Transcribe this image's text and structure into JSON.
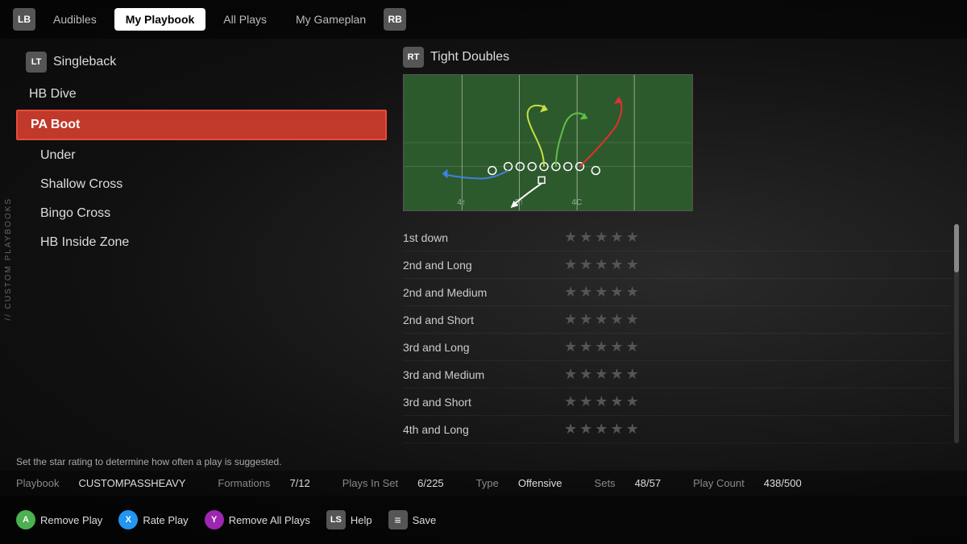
{
  "nav": {
    "lb_label": "LB",
    "rb_label": "RB",
    "tabs": [
      {
        "label": "Audibles",
        "active": false
      },
      {
        "label": "My Playbook",
        "active": true
      },
      {
        "label": "All Plays",
        "active": false
      },
      {
        "label": "My Gameplan",
        "active": false
      }
    ]
  },
  "side_label": "// CUSTOM PLAYBOOKS",
  "left_panel": {
    "formation_badge": "LT",
    "formation_name": "Singleback",
    "plays": [
      {
        "label": "HB Dive",
        "selected": false,
        "indented": false
      },
      {
        "label": "PA Boot",
        "selected": true,
        "indented": false
      },
      {
        "label": "Under",
        "selected": false,
        "indented": true
      },
      {
        "label": "Shallow Cross",
        "selected": false,
        "indented": true
      },
      {
        "label": "Bingo Cross",
        "selected": false,
        "indented": true
      },
      {
        "label": "HB Inside Zone",
        "selected": false,
        "indented": true
      }
    ]
  },
  "right_panel": {
    "set_badge": "RT",
    "set_name": "Tight Doubles",
    "ratings": [
      {
        "label": "1st down",
        "stars": 0
      },
      {
        "label": "2nd and Long",
        "stars": 0
      },
      {
        "label": "2nd and Medium",
        "stars": 0
      },
      {
        "label": "2nd and Short",
        "stars": 0
      },
      {
        "label": "3rd and Long",
        "stars": 0
      },
      {
        "label": "3rd and Medium",
        "stars": 0
      },
      {
        "label": "3rd and Short",
        "stars": 0
      },
      {
        "label": "4th and Long",
        "stars": 0
      }
    ],
    "max_stars": 5
  },
  "info_text": "Set the star rating to determine how often a play is suggested.",
  "stats": {
    "playbook_label": "Playbook",
    "playbook_value": "CUSTOMPASSHEAVY",
    "formations_label": "Formations",
    "formations_value": "7/12",
    "plays_in_set_label": "Plays In Set",
    "plays_in_set_value": "6/225",
    "type_label": "Type",
    "type_value": "Offensive",
    "sets_label": "Sets",
    "sets_value": "48/57",
    "play_count_label": "Play Count",
    "play_count_value": "438/500"
  },
  "bottom_bar": {
    "buttons": [
      {
        "badge": "A",
        "badge_class": "a",
        "label": "Remove Play"
      },
      {
        "badge": "X",
        "badge_class": "x",
        "label": "Rate Play"
      },
      {
        "badge": "Y",
        "badge_class": "y",
        "label": "Remove All Plays"
      },
      {
        "badge": "LS",
        "badge_class": "ls",
        "label": "Help"
      },
      {
        "badge": "≡",
        "badge_class": "eq",
        "label": "Save"
      }
    ]
  }
}
